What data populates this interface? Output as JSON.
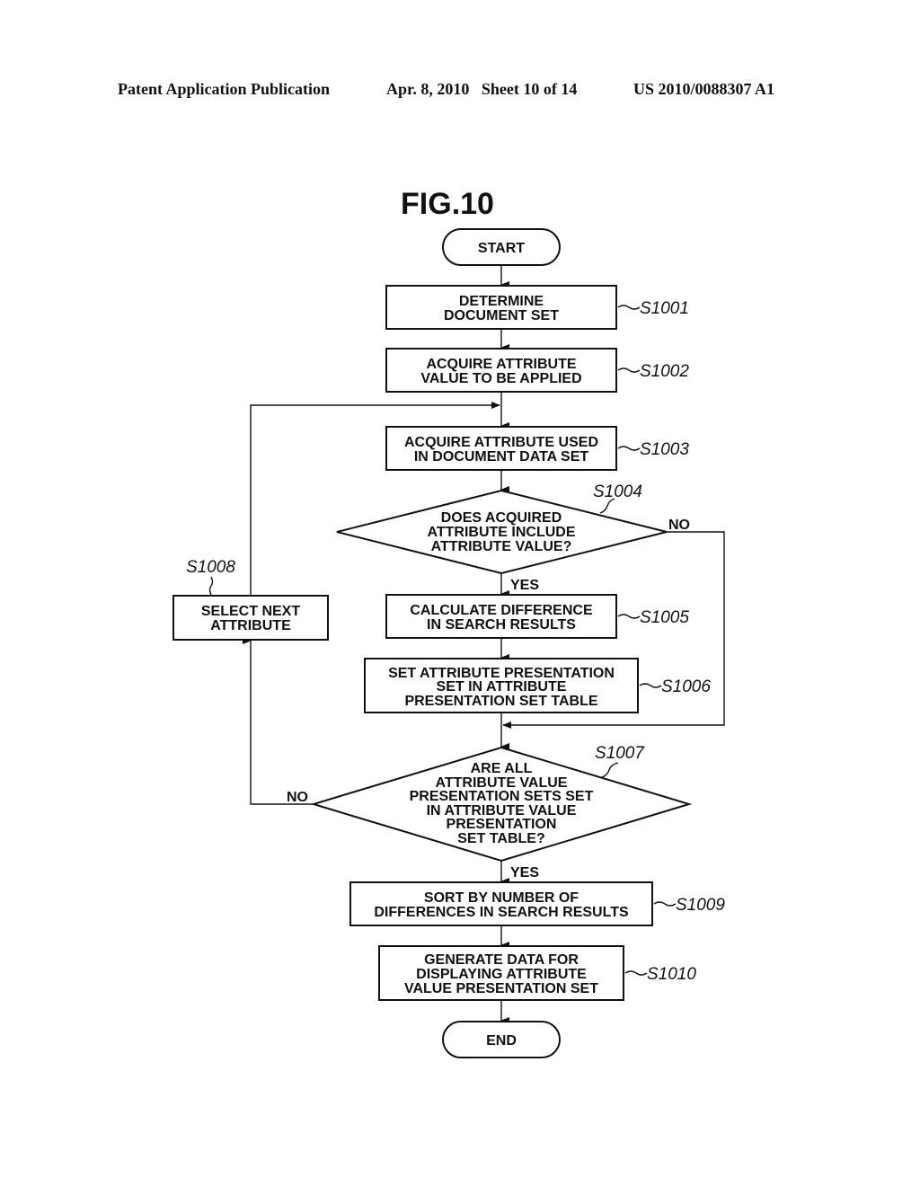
{
  "header": {
    "publication": "Patent Application Publication",
    "date_sheet": "Apr. 8, 2010   Sheet 10 of 14",
    "number": "US 2010/0088307 A1"
  },
  "figure": {
    "title": "FIG.10",
    "start": "START",
    "end": "END",
    "steps": {
      "s1001": {
        "label": "S1001",
        "lines": [
          "DETERMINE",
          "DOCUMENT SET"
        ]
      },
      "s1002": {
        "label": "S1002",
        "lines": [
          "ACQUIRE ATTRIBUTE",
          "VALUE TO BE APPLIED"
        ]
      },
      "s1003": {
        "label": "S1003",
        "lines": [
          "ACQUIRE ATTRIBUTE USED",
          "IN DOCUMENT DATA SET"
        ]
      },
      "s1004": {
        "label": "S1004",
        "lines": [
          "DOES ACQUIRED",
          "ATTRIBUTE INCLUDE",
          "ATTRIBUTE VALUE?"
        ]
      },
      "s1005": {
        "label": "S1005",
        "lines": [
          "CALCULATE DIFFERENCE",
          "IN SEARCH RESULTS"
        ]
      },
      "s1006": {
        "label": "S1006",
        "lines": [
          "SET ATTRIBUTE PRESENTATION",
          "SET IN ATTRIBUTE",
          "PRESENTATION SET TABLE"
        ]
      },
      "s1007": {
        "label": "S1007",
        "lines": [
          "ARE ALL",
          "ATTRIBUTE VALUE",
          "PRESENTATION SETS SET",
          "IN ATTRIBUTE VALUE",
          "PRESENTATION",
          "SET TABLE?"
        ]
      },
      "s1008": {
        "label": "S1008",
        "lines": [
          "SELECT NEXT",
          "ATTRIBUTE"
        ]
      },
      "s1009": {
        "label": "S1009",
        "lines": [
          "SORT BY NUMBER OF",
          "DIFFERENCES IN SEARCH RESULTS"
        ]
      },
      "s1010": {
        "label": "S1010",
        "lines": [
          "GENERATE DATA FOR",
          "DISPLAYING ATTRIBUTE",
          "VALUE PRESENTATION SET"
        ]
      }
    },
    "branches": {
      "yes": "YES",
      "no": "NO"
    }
  }
}
